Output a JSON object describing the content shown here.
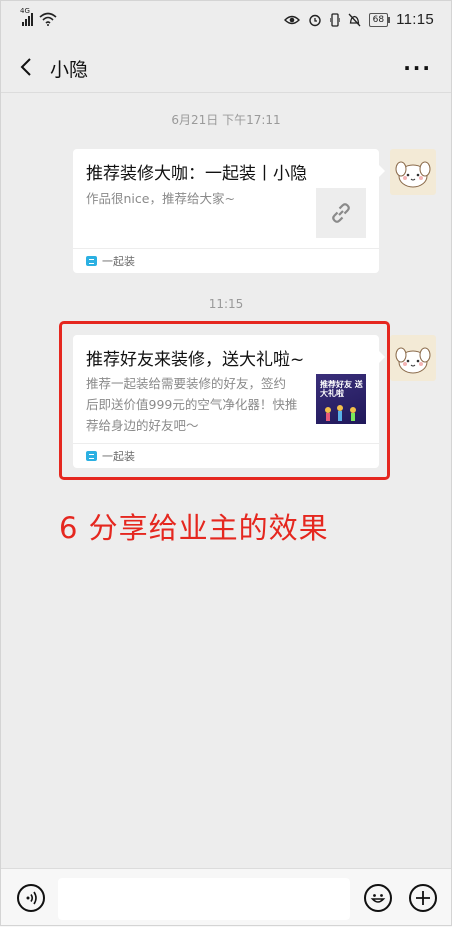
{
  "status_bar": {
    "network": "4G",
    "battery": "68",
    "time": "11:15"
  },
  "header": {
    "title": "小隐"
  },
  "messages": [
    {
      "timestamp": "6月21日 下午17:11",
      "card_title": "推荐装修大咖：一起装丨小隐",
      "card_desc": "作品很nice，推荐给大家~",
      "source": "一起装"
    },
    {
      "timestamp": "11:15",
      "card_title": "推荐好友来装修，送大礼啦~",
      "card_desc_lines": [
        "推荐一起装给需要装修的好友，签约",
        "后即送价值999元的空气净化器！快推",
        "荐给身边的好友吧～"
      ],
      "source": "一起装",
      "thumb_text": "推荐好友 送大礼啦"
    }
  ],
  "annotation": "6  分享给业主的效果",
  "colors": {
    "background": "#ededed",
    "annotation_red": "#e5271f",
    "app_icon": "#2bb0e2"
  }
}
